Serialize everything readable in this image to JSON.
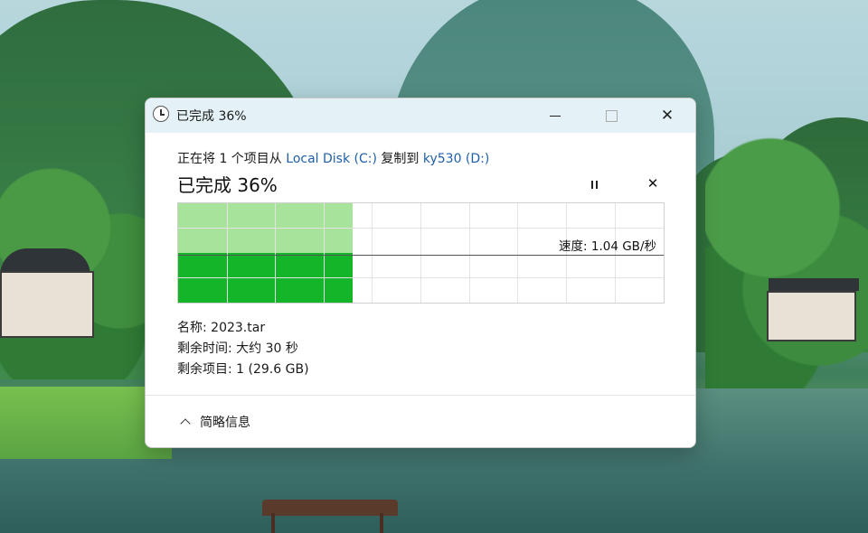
{
  "window": {
    "title": "已完成 36%",
    "title_icon": "clock-icon"
  },
  "copy": {
    "prefix": "正在将 1 个项目从 ",
    "source": "Local Disk (C:)",
    "middle": " 复制到 ",
    "destination": "ky530 (D:)",
    "status": "已完成 36%",
    "progress": 0.36,
    "speed": "速度: 1.04 GB/秒"
  },
  "controls": {
    "pause_icon": "pause-icon",
    "cancel_icon": "close-icon",
    "cancel_glyph": "✕",
    "close_glyph": "✕"
  },
  "file": {
    "name_label": "名称:",
    "name": "2023.tar",
    "time_label": "剩余时间:",
    "time": "大约 30 秒",
    "items_label": "剩余项目:",
    "items": "1 (29.6 GB)"
  },
  "footer": {
    "details_label": "简略信息"
  },
  "colors": {
    "progress_light": "#a8e39c",
    "progress_dark": "#15b52a",
    "link": "#1f5fa8",
    "titlebar": "#e4f2f7"
  }
}
